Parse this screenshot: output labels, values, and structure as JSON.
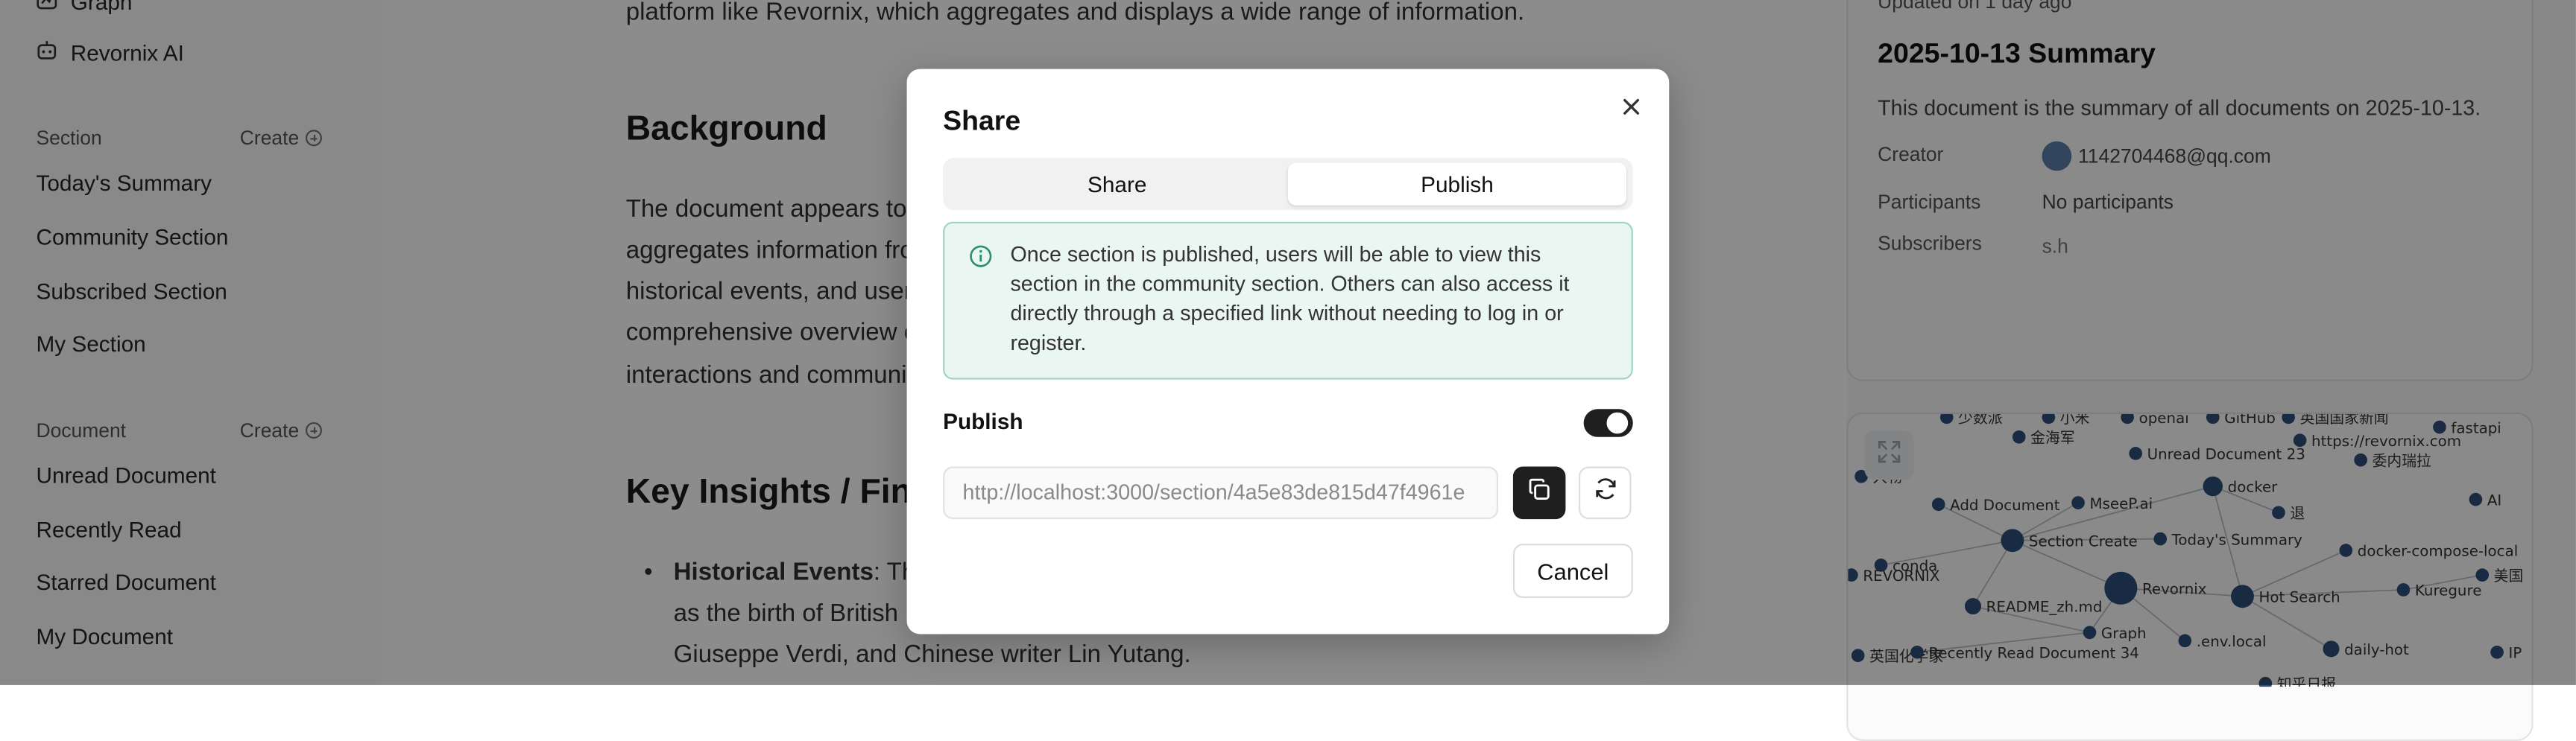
{
  "sidebar": {
    "top_items": [
      {
        "label": "Graph",
        "icon": "graph-icon"
      },
      {
        "label": "Revornix AI",
        "icon": "robot-icon"
      }
    ],
    "section_group": {
      "label": "Section",
      "create_label": "Create",
      "items": [
        "Today's Summary",
        "Community Section",
        "Subscribed Section",
        "My Section"
      ]
    },
    "document_group": {
      "label": "Document",
      "create_label": "Create",
      "items": [
        "Unread Document",
        "Recently Read",
        "Starred Document",
        "My Document"
      ]
    }
  },
  "main": {
    "intro_line": "platform like Revornix, which aggregates and displays a wide range of information.",
    "background_heading": "Background",
    "background_lines": [
      "The document appears to",
      "aggregates information fro",
      "historical events, and user",
      "comprehensive overview o",
      "interactions and communi"
    ],
    "insights_heading": "Key Insights / Fin",
    "bullet": {
      "bold": "Historical Events",
      "text": ": The",
      "line2": "as the birth of British",
      "line3": "Giuseppe Verdi, and Chinese writer Lin Yutang."
    }
  },
  "right_panel": {
    "updated": "Updated on 1 day ago",
    "title": "2025-10-13 Summary",
    "description": "This document is the summary of all documents on 2025-10-13.",
    "creator_label": "Creator",
    "creator_value": "1142704468@qq.com",
    "participants_label": "Participants",
    "participants_value": "No participants",
    "subscribers_label": "Subscribers",
    "subscribers_value": "s.h",
    "graph_nodes": [
      {
        "label": "少数派"
      },
      {
        "label": "小米"
      },
      {
        "label": "openai"
      },
      {
        "label": "GitHub"
      },
      {
        "label": "英国国家新闻"
      },
      {
        "label": "fastapi"
      },
      {
        "label": "金海军"
      },
      {
        "label": "https://revornix.com"
      },
      {
        "label": "Unread Document 23"
      },
      {
        "label": "委内瑞拉"
      },
      {
        "label": "人物"
      },
      {
        "label": "docker"
      },
      {
        "label": "Add Document"
      },
      {
        "label": "MseeP.ai"
      },
      {
        "label": "退"
      },
      {
        "label": "AI"
      },
      {
        "label": "Section Create"
      },
      {
        "label": "Today's Summary"
      },
      {
        "label": "docker-compose-local"
      },
      {
        "label": "conda"
      },
      {
        "label": "REVORNIX"
      },
      {
        "label": "Revornix"
      },
      {
        "label": "Hot Search"
      },
      {
        "label": "美国"
      },
      {
        "label": "Kuregure"
      },
      {
        "label": "README_zh.md"
      },
      {
        "label": "Graph"
      },
      {
        "label": ".env.local"
      },
      {
        "label": "daily-hot"
      },
      {
        "label": "英国化学家"
      },
      {
        "label": "Recently Read Document 34"
      },
      {
        "label": "知乎日报"
      },
      {
        "label": "IP"
      }
    ]
  },
  "modal": {
    "title": "Share",
    "tabs": [
      {
        "label": "Share",
        "active": false
      },
      {
        "label": "Publish",
        "active": true
      }
    ],
    "info_text": "Once section is published, users will be able to view this section in the community section. Others can also access it directly through a specified link without needing to log in or register.",
    "publish_label": "Publish",
    "publish_enabled": true,
    "url": "http://localhost:3000/section/4a5e83de815d47f4961e",
    "cancel_label": "Cancel"
  },
  "colors": {
    "info_bg": "#eaf6f1",
    "info_border": "#9fd6c0",
    "info_icon": "#2f8f6b",
    "dark_button": "#1f1f1f",
    "graph_node": "#2e4d7a"
  }
}
